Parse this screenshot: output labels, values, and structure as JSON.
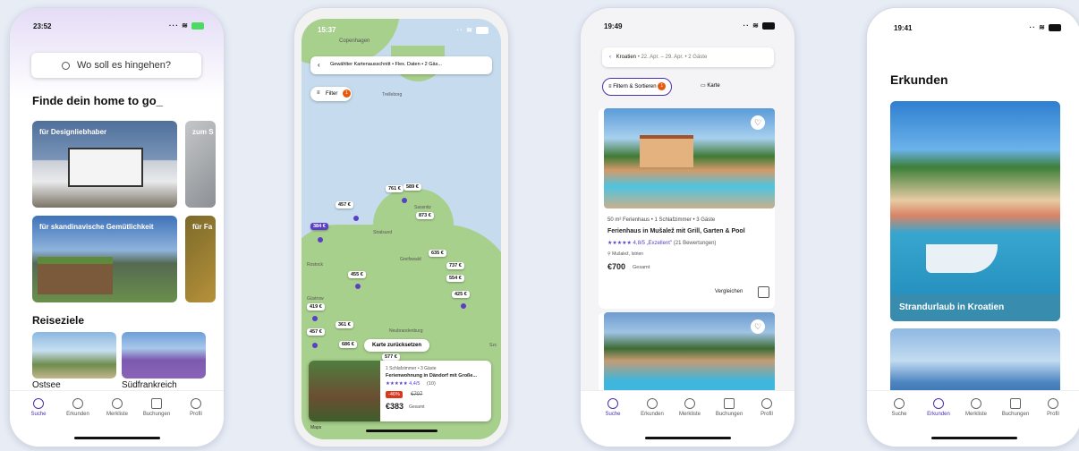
{
  "phone1": {
    "time": "23:52",
    "search_placeholder": "Wo soll es hingehen?",
    "heading": "Finde dein home to go_",
    "cards": [
      "für Designliebhaber",
      "zum S",
      "für skandinavische Gemütlichkeit",
      "für Fa"
    ],
    "destinations_heading": "Reiseziele",
    "destinations": [
      "Ostsee",
      "Südfrankreich"
    ]
  },
  "phone2": {
    "time": "15:37",
    "top_bar": "Gewählter Kartenausschnitt • Flex. Daten • 2 Gäs...",
    "filter_label": "Filter",
    "filter_badge": "1",
    "places": [
      "Copenhagen",
      "Trelleborg",
      "Sassnitz",
      "Stralsund",
      "Greifswald",
      "Rostock",
      "Güstrow",
      "Neubrandenburg",
      "Szc"
    ],
    "pins": [
      "761 €",
      "589 €",
      "457 €",
      "873 €",
      "384 €",
      "635 €",
      "737 €",
      "554 €",
      "455 €",
      "425 €",
      "419 €",
      "457 €",
      "361 €",
      "686 €",
      "577 €"
    ],
    "reset_button": "Karte zurücksetzen",
    "listing": {
      "meta": "1 Schlafzimmer • 3 Gäste",
      "title": "Ferienwohnung in Dändorf mit Große...",
      "rating": "★★★★★ 4,4/5",
      "reviews": "(10)",
      "discount": "-46%",
      "old_price": "€707",
      "price": "€383",
      "price_suffix": "Gesamt"
    },
    "maps_attribution": "Maps"
  },
  "phone3": {
    "time": "19:49",
    "top_bar_location": "Kroatien",
    "top_bar_details": "• 22. Apr. – 29. Apr. • 2 Gäste",
    "filter_chip": "Filtern & Sortieren",
    "filter_badge": "1",
    "map_chip": "Karte",
    "listing": {
      "meta": "50 m² Ferienhaus • 1 Schlafzimmer • 3 Gäste",
      "title": "Ferienhaus in Mušalež mit Grill, Garten & Pool",
      "rating": "★★★★★ 4,8/5",
      "rating_label": "„Exzellent\"",
      "reviews": "(21 Bewertungen)",
      "location": "Mušalež, Istrien",
      "price": "€700",
      "price_suffix": "Gesamt",
      "compare": "Vergleichen"
    }
  },
  "phone4": {
    "time": "19:41",
    "heading": "Erkunden",
    "card_label": "Strandurlaub in Kroatien"
  },
  "tabs": [
    "Suche",
    "Erkunden",
    "Merkliste",
    "Buchungen",
    "Profil"
  ],
  "colors": {
    "accent": "#4a2fb0",
    "pin_selected": "#5b3fc8",
    "badge": "#e8590c"
  }
}
